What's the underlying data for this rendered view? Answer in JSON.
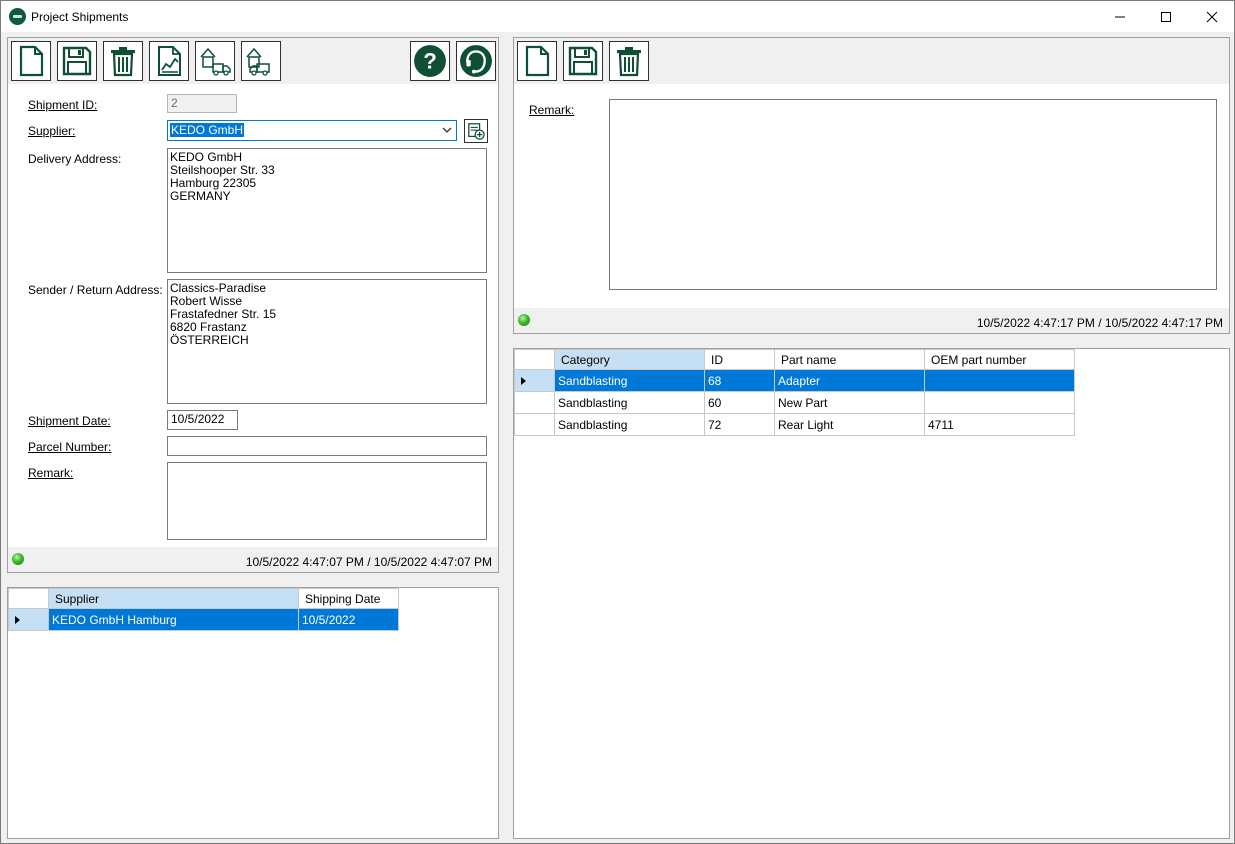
{
  "window": {
    "title": "Project Shipments"
  },
  "shipment_form": {
    "toolbar": {
      "new": "new-document-icon",
      "save": "save-icon",
      "delete": "trash-icon",
      "report": "chart-report-icon",
      "ship_to": "house-truck-icon",
      "ship_from": "house-truck-return-icon",
      "help": "help-icon",
      "support": "support-headset-icon"
    },
    "labels": {
      "shipment_id": "Shipment ID:",
      "supplier": "Supplier:",
      "delivery_address": "Delivery Address:",
      "sender_address": "Sender / Return Address:",
      "shipment_date": "Shipment Date:",
      "parcel_number": "Parcel Number:",
      "remark": "Remark:"
    },
    "values": {
      "shipment_id": "2",
      "supplier": "KEDO GmbH",
      "delivery_address": "KEDO GmbH\nSteilshooper Str. 33\nHamburg 22305\nGERMANY",
      "sender_address": "Classics-Paradise\nRobert Wisse\nFrastafedner Str. 15\n6820 Frastanz\nÖSTERREICH",
      "shipment_date": "10/5/2022",
      "parcel_number": "",
      "remark": ""
    },
    "status": {
      "timestamps": "10/5/2022 4:47:07 PM / 10/5/2022 4:47:07 PM"
    }
  },
  "shipments_grid": {
    "columns": [
      "Supplier",
      "Shipping Date"
    ],
    "rows": [
      {
        "supplier": "KEDO GmbH Hamburg",
        "date": "10/5/2022"
      }
    ]
  },
  "part_form": {
    "labels": {
      "remark": "Remark:"
    },
    "values": {
      "remark": ""
    },
    "status": {
      "timestamps": "10/5/2022 4:47:17 PM / 10/5/2022 4:47:17 PM"
    }
  },
  "parts_grid": {
    "columns": [
      "Category",
      "ID",
      "Part name",
      "OEM part number"
    ],
    "rows": [
      {
        "category": "Sandblasting",
        "id": "68",
        "name": "Adapter",
        "oem": ""
      },
      {
        "category": "Sandblasting",
        "id": "60",
        "name": "New Part",
        "oem": ""
      },
      {
        "category": "Sandblasting",
        "id": "72",
        "name": "Rear Light",
        "oem": "4711"
      }
    ]
  },
  "colors": {
    "icon_green": "#0f4f34",
    "selection": "#0078d7",
    "header_highlight": "#c5e0f5"
  }
}
